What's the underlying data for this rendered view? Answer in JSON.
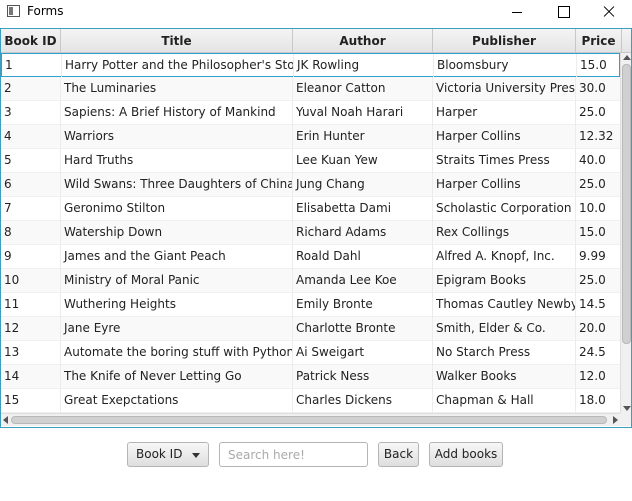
{
  "window": {
    "title": "Forms"
  },
  "table": {
    "columns": [
      "Book ID",
      "Title",
      "Author",
      "Publisher",
      "Price"
    ],
    "rows": [
      [
        "1",
        "Harry Potter and the Philosopher's Stone",
        "JK Rowling",
        "Bloomsbury",
        "15.0"
      ],
      [
        "2",
        "The Luminaries",
        "Eleanor Catton",
        "Victoria University Press",
        "30.0"
      ],
      [
        "3",
        "Sapiens: A Brief History of  Mankind",
        "Yuval Noah Harari",
        "Harper",
        "25.0"
      ],
      [
        "4",
        "Warriors",
        "Erin Hunter",
        "Harper Collins",
        "12.32"
      ],
      [
        "5",
        "Hard Truths",
        "Lee Kuan Yew",
        "Straits Times Press",
        "40.0"
      ],
      [
        "6",
        "Wild Swans: Three Daughters of China",
        "Jung Chang",
        "Harper Collins",
        "25.0"
      ],
      [
        "7",
        "Geronimo Stilton",
        "Elisabetta Dami",
        "Scholastic Corporation",
        "10.0"
      ],
      [
        "8",
        "Watership Down",
        "Richard Adams",
        "Rex Collings",
        "15.0"
      ],
      [
        "9",
        "James and the Giant Peach",
        "Roald Dahl",
        "Alfred A. Knopf, Inc.",
        "9.99"
      ],
      [
        "10",
        "Ministry of Moral Panic",
        "Amanda Lee Koe",
        "Epigram Books",
        "25.0"
      ],
      [
        "11",
        "Wuthering Heights",
        "Emily Bronte",
        "Thomas Cautley Newby",
        "14.5"
      ],
      [
        "12",
        "Jane Eyre",
        "Charlotte Bronte",
        "Smith, Elder & Co.",
        "20.0"
      ],
      [
        "13",
        "Automate the boring stuff with Python",
        "Ai Sweigart",
        "No Starch Press",
        "24.5"
      ],
      [
        "14",
        "The Knife of Never Letting Go",
        "Patrick Ness",
        "Walker Books",
        "12.0"
      ],
      [
        "15",
        "Great Exepctations",
        "Charles Dickens",
        "Chapman & Hall",
        "18.0"
      ]
    ],
    "selected_row": 0
  },
  "controls": {
    "search_by": "Book ID",
    "search_placeholder": "Search here!",
    "back_label": "Back",
    "add_label": "Add books"
  }
}
